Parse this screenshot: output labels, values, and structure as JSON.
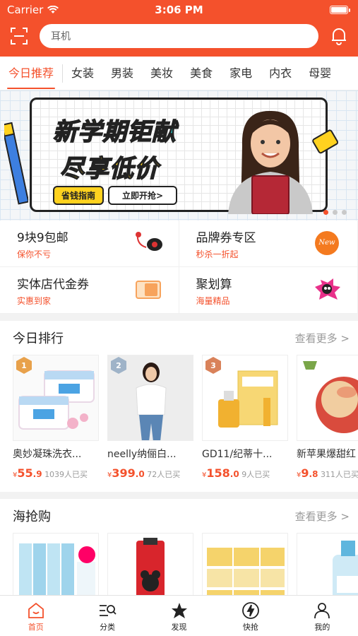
{
  "status": {
    "carrier": "Carrier",
    "time": "3:06 PM"
  },
  "search": {
    "placeholder": "耳机"
  },
  "tabs": [
    "今日推荐",
    "女装",
    "男装",
    "美妆",
    "美食",
    "家电",
    "内衣",
    "母婴"
  ],
  "banner": {
    "line1a": "新学期",
    "line1b": "钜献",
    "line2": "尽享低价",
    "btn1": "省钱指南",
    "btn2": "立即开抢>"
  },
  "quick": [
    {
      "title": "9块9包邮",
      "subtitle": "保你不亏",
      "icon": "earphone-icon"
    },
    {
      "title": "品牌券专区",
      "subtitle": "秒杀一折起",
      "icon": "new-badge-icon"
    },
    {
      "title": "实体店代金券",
      "subtitle": "实惠到家",
      "icon": "coupon-icon"
    },
    {
      "title": "聚划算",
      "subtitle": "海量精品",
      "icon": "mascot-icon"
    }
  ],
  "ranking": {
    "title": "今日排行",
    "more": "查看更多 >",
    "items": [
      {
        "rank": "1",
        "name": "奥妙凝珠洗衣...",
        "price_int": "55",
        "price_dec": ".9",
        "sold": "1039人已买"
      },
      {
        "rank": "2",
        "name": "neelly纳俪白...",
        "price_int": "399",
        "price_dec": ".0",
        "sold": "72人已买"
      },
      {
        "rank": "3",
        "name": "GD11/纪蒂十...",
        "price_int": "158",
        "price_dec": ".0",
        "sold": "9人已买"
      },
      {
        "rank": "",
        "name": "新苹果爆甜红",
        "price_int": "9",
        "price_dec": ".8",
        "sold": "311人已买"
      }
    ]
  },
  "overseas": {
    "title": "海抢购",
    "more": "查看更多 >"
  },
  "tabbar": [
    "首页",
    "分类",
    "发现",
    "快抢",
    "我的"
  ],
  "colors": {
    "accent": "#f4512c"
  }
}
